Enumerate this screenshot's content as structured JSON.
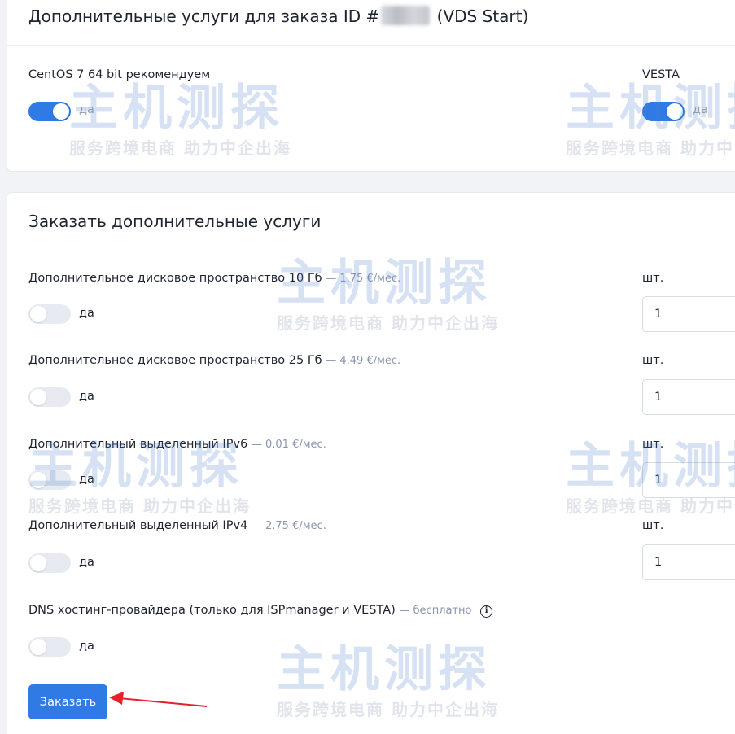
{
  "top_card": {
    "title_prefix": "Дополнительные услуги для заказа ID #",
    "title_suffix": " (VDS Start)",
    "options": [
      {
        "label": "CentOS 7 64 bit рекомендуем",
        "toggle_text": "да",
        "state": "on"
      },
      {
        "label": "VESTA",
        "toggle_text": "да",
        "state": "on"
      }
    ]
  },
  "bottom_card": {
    "title": "Заказать дополнительные услуги",
    "services": [
      {
        "label": "Дополнительное дисковое пространство 10 Гб",
        "price": "— 1.75 €/мес.",
        "toggle_text": "да",
        "qty_label": "шт.",
        "qty_value": "1"
      },
      {
        "label": "Дополнительное дисковое пространство 25 Гб",
        "price": "— 4.49 €/мес.",
        "toggle_text": "да",
        "qty_label": "шт.",
        "qty_value": "1"
      },
      {
        "label": "Дополнительный выделенный IPv6",
        "price": "— 0.01 €/мес.",
        "toggle_text": "да",
        "qty_label": "шт.",
        "qty_value": "1"
      },
      {
        "label": "Дополнительный выделенный IPv4",
        "price": "— 2.75 €/мес.",
        "toggle_text": "да",
        "qty_label": "шт.",
        "qty_value": "1"
      },
      {
        "label": "DNS хостинг-провайдера (только для ISPmanager и VESTA)",
        "price": "— бесплатно",
        "toggle_text": "да",
        "info_icon": "info-icon"
      }
    ],
    "order_button": "Заказать"
  },
  "watermark": {
    "main": "主机测探",
    "sub": "服务跨境电商 助力中企出海"
  },
  "colors": {
    "accent": "#2f7ae5",
    "price_text": "#8a97ad",
    "annotation_arrow": "#e8202a"
  }
}
